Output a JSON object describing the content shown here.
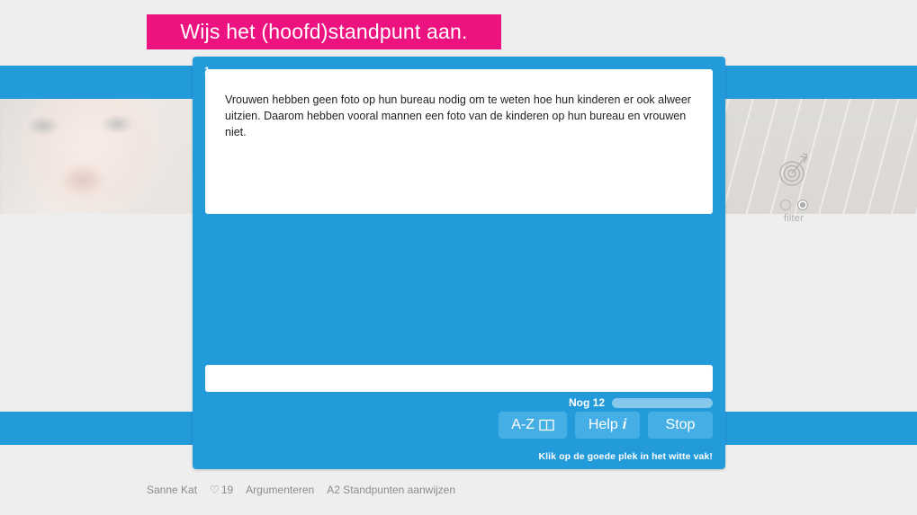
{
  "title": {
    "text": "Wijs het (hoofd)standpunt aan.",
    "background_color": "#ec1280",
    "text_color": "#ffffff"
  },
  "theme": {
    "accent_blue": "#239bdb",
    "button_blue": "#45aee4",
    "page_background": "#eeeeee",
    "pink": "#ec1280"
  },
  "dialog": {
    "badge_number": "1",
    "statement": "Vrouwen hebben geen foto op hun bureau nodig om te weten hoe hun kinderen er ook alweer uitzien. Daarom hebben vooral mannen een foto van de kinderen op hun bureau en vrouwen niet.",
    "answer_value": "",
    "answer_placeholder": "",
    "progress": {
      "label": "Nog 12",
      "remaining": 12,
      "percent": 100
    },
    "buttons": [
      {
        "label": "A-Z",
        "icon": "book-icon",
        "name": "az-button"
      },
      {
        "label": "Help",
        "icon": "info-i-icon",
        "name": "help-button"
      },
      {
        "label": "Stop",
        "icon": "",
        "name": "stop-button"
      }
    ],
    "hint": "Klik op de goede plek in het witte vak!"
  },
  "filter_widget": {
    "icon": "target-icon",
    "label": "filter",
    "options": [
      {
        "selected": false
      },
      {
        "selected": true
      }
    ]
  },
  "footer": {
    "user_name": "Sanne Kat",
    "heart_icon": "♡",
    "heart_count": "19",
    "category": "Argumenteren",
    "lesson": "A2 Standpunten aanwijzen"
  }
}
